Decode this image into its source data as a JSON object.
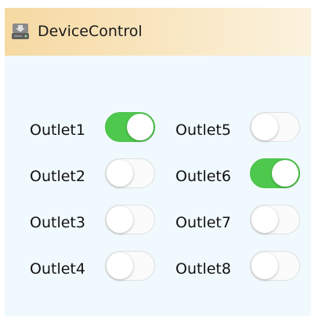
{
  "window": {
    "title": "DeviceControl",
    "icon": "drive-icon"
  },
  "outlets": [
    {
      "label": "Outlet1",
      "on": true
    },
    {
      "label": "Outlet2",
      "on": false
    },
    {
      "label": "Outlet3",
      "on": false
    },
    {
      "label": "Outlet4",
      "on": false
    },
    {
      "label": "Outlet5",
      "on": false
    },
    {
      "label": "Outlet6",
      "on": true
    },
    {
      "label": "Outlet7",
      "on": false
    },
    {
      "label": "Outlet8",
      "on": false
    }
  ],
  "colors": {
    "switch_on": "#4ec94e",
    "switch_off": "#fbfbfb",
    "titlebar": "#f6d9a2",
    "panel": "#f0f9fd"
  }
}
